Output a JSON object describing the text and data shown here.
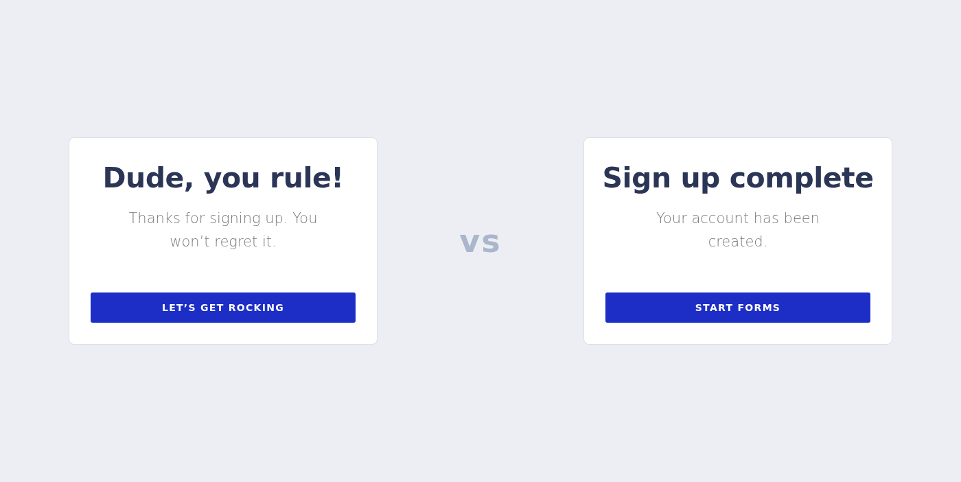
{
  "cards": [
    {
      "title": "Dude, you rule!",
      "message": "Thanks for signing up. You won’t regret it.",
      "button": "LET’S GET ROCKING"
    },
    {
      "title": "Sign up complete",
      "message": "Your account has been created.",
      "button": "START FORMS"
    }
  ],
  "separator": "vs"
}
